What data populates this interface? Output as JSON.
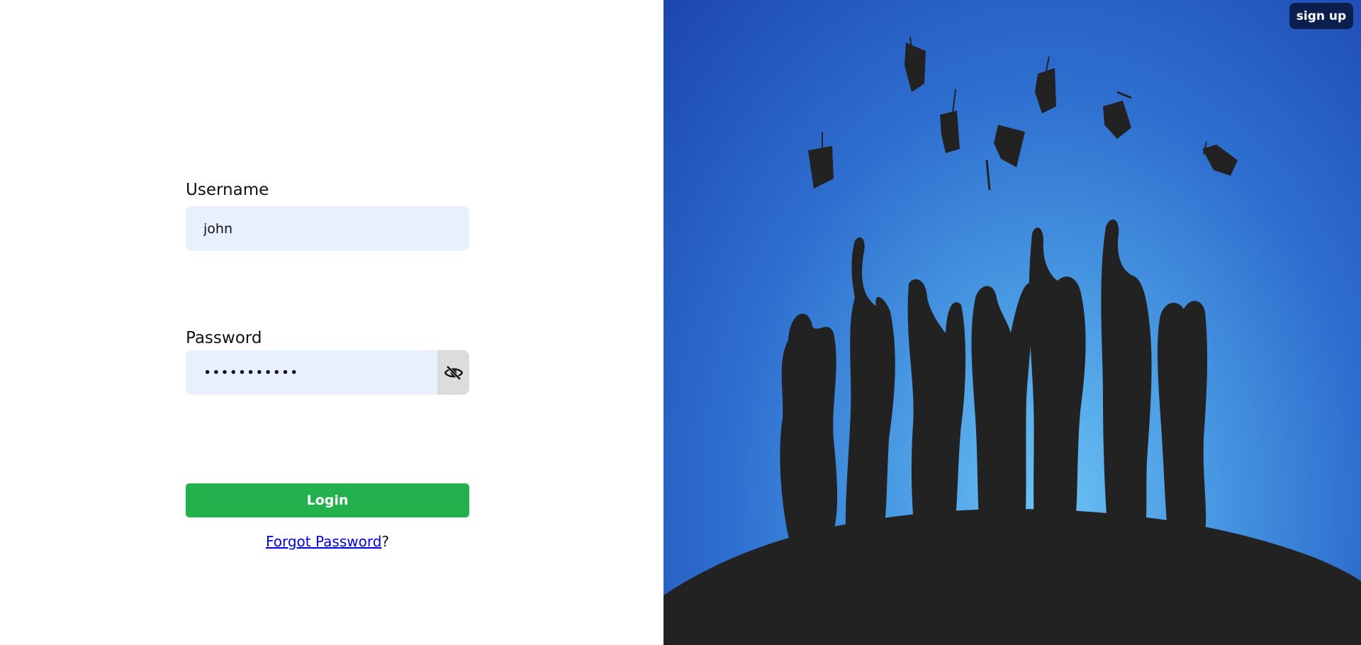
{
  "login_form": {
    "username_label": "Username",
    "username_value": "john",
    "password_label": "Password",
    "password_value": "•••••••••••",
    "login_label": "Login",
    "forgot_link_text": "Forgot Password",
    "forgot_suffix": "?"
  },
  "header": {
    "signup_label": "sign up"
  },
  "icons": {
    "password_toggle": "eye-slash-icon"
  },
  "colors": {
    "login_button": "#22b14c",
    "input_background": "#e8f0fe",
    "signup_button": "#0b1f4f",
    "sky_top": "#1c46b0",
    "sky_center": "#6cc2f4",
    "silhouette": "#222222"
  }
}
